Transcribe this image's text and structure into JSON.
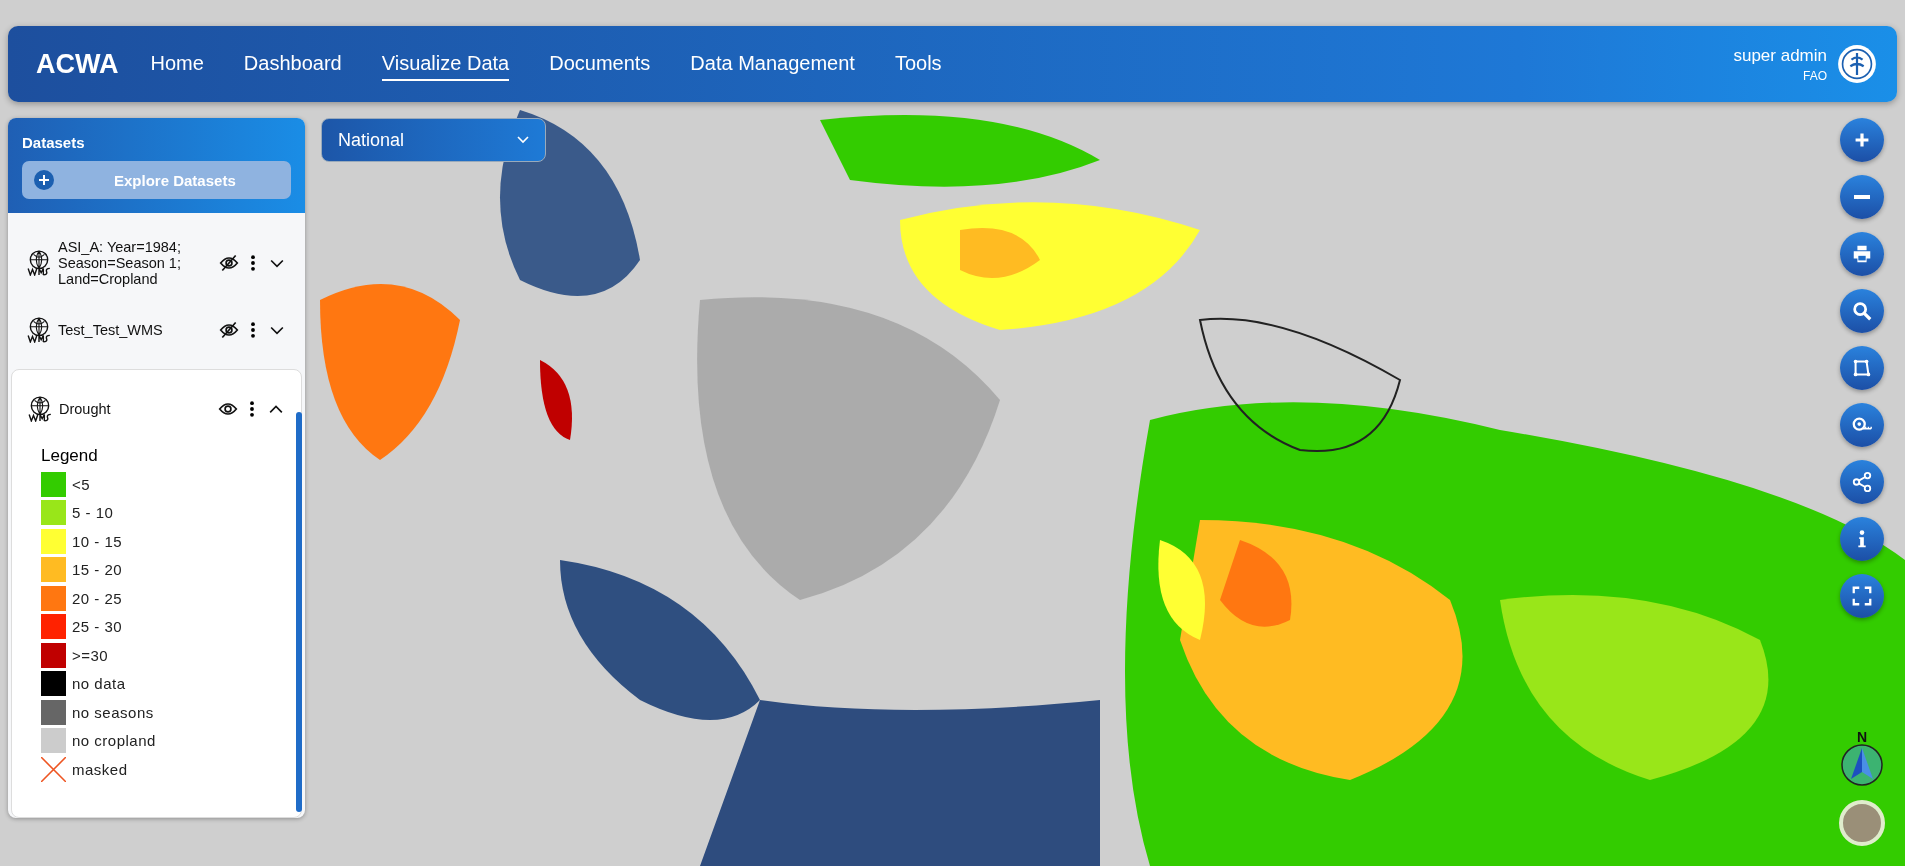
{
  "header": {
    "brand": "ACWA",
    "nav": [
      {
        "label": "Home",
        "selected": false
      },
      {
        "label": "Dashboard",
        "selected": false
      },
      {
        "label": "Visualize Data",
        "selected": true
      },
      {
        "label": "Documents",
        "selected": false
      },
      {
        "label": "Data Management",
        "selected": false
      },
      {
        "label": "Tools",
        "selected": false
      }
    ],
    "user": {
      "name": "super admin",
      "org": "FAO"
    }
  },
  "sidebar": {
    "title": "Datasets",
    "explore_button": "Explore Datasets",
    "layers": [
      {
        "name": "ASI_A: Year=1984; Season=Season 1; Land=Cropland",
        "visible": false,
        "expanded": false
      },
      {
        "name": "Test_Test_WMS",
        "visible": false,
        "expanded": false
      },
      {
        "name": "Drought",
        "visible": true,
        "expanded": true
      }
    ],
    "legend": {
      "title": "Legend",
      "items": [
        {
          "label": "<5",
          "color": "#33cc00",
          "kind": "swatch"
        },
        {
          "label": "5 - 10",
          "color": "#99e619",
          "kind": "swatch"
        },
        {
          "label": "10 - 15",
          "color": "#ffff33",
          "kind": "swatch"
        },
        {
          "label": "15 - 20",
          "color": "#ffbb22",
          "kind": "swatch"
        },
        {
          "label": "20 - 25",
          "color": "#ff7711",
          "kind": "swatch"
        },
        {
          "label": "25 - 30",
          "color": "#ff2200",
          "kind": "swatch"
        },
        {
          "label": ">=30",
          "color": "#c00000",
          "kind": "swatch"
        },
        {
          "label": "no data",
          "color": "#000000",
          "kind": "swatch"
        },
        {
          "label": "no seasons",
          "color": "#666666",
          "kind": "swatch"
        },
        {
          "label": "no cropland",
          "color": "#cccccc",
          "kind": "swatch"
        },
        {
          "label": "masked",
          "color": "#ee5522",
          "kind": "cross"
        }
      ]
    }
  },
  "level_select": {
    "value": "National"
  },
  "map_tools": [
    {
      "kind": "zoom-in"
    },
    {
      "kind": "zoom-out"
    },
    {
      "kind": "print"
    },
    {
      "kind": "search"
    },
    {
      "kind": "draw"
    },
    {
      "kind": "measure"
    },
    {
      "kind": "share"
    },
    {
      "kind": "info"
    },
    {
      "kind": "fullscreen"
    }
  ],
  "compass": {
    "label": "N"
  }
}
